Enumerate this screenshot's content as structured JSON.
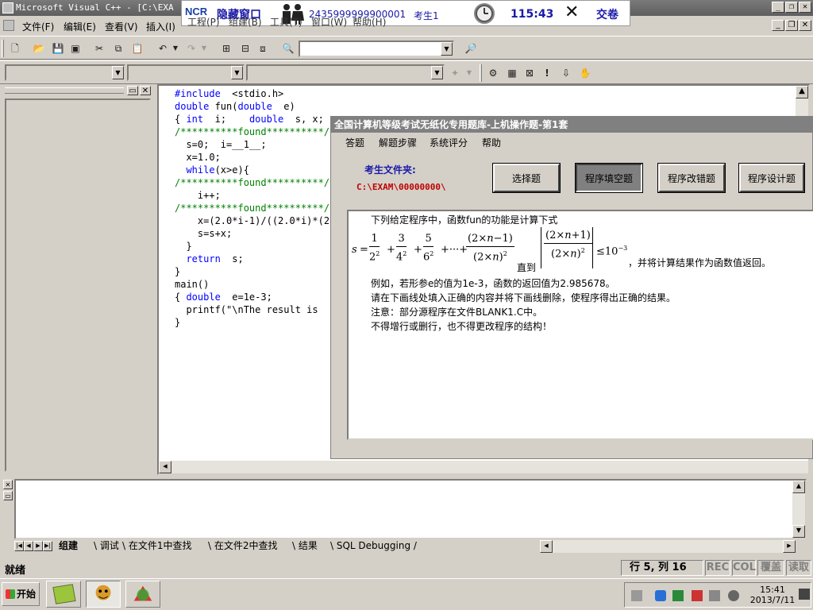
{
  "window": {
    "title": "Microsoft Visual C++ - [C:\\EXA"
  },
  "banner": {
    "logo": "NCR",
    "hide_window": "隐藏窗口",
    "exam_id": "2435999999900001",
    "examinee": "考生1",
    "timer": "115:43",
    "submit": "交卷"
  },
  "menu": [
    "文件(F)",
    "编辑(E)",
    "查看(V)",
    "插入(I)",
    "工程(P)",
    "组建(B)",
    "工具(T)",
    "窗口(W)",
    "帮助(H)"
  ],
  "code": {
    "lines": [
      "#include  <stdio.h>",
      "double fun(double  e)",
      "{ int  i;    double  s, x;",
      "/**********found**********/",
      "  s=0;  i=__1__;",
      "  x=1.0;",
      "  while(x>e){",
      "/**********found**********/",
      "    i++;",
      "/**********found**********/",
      "    x=(2.0*i-1)/((2.0*i)*(2.0*i));",
      "    s=s+x;",
      "  }",
      "  return  s;",
      "}",
      "main()",
      "{ double  e=1e-3;",
      "  printf(\"\\nThe result is",
      "}"
    ]
  },
  "dialog": {
    "title": "全国计算机等级考试无纸化专用题库-上机操作题-第1套",
    "menu": [
      "答题",
      "解题步骤",
      "系统评分",
      "帮助"
    ],
    "folder_label": "考生文件夹:",
    "folder_path": "C:\\EXAM\\00000000\\",
    "buttons": [
      "选择题",
      "程序填空题",
      "程序改错题",
      "程序设计题"
    ],
    "active_button": "程序填空题",
    "question": {
      "line1": "下列给定程序中，函数fun的功能是计算下式",
      "formula_until": "直到",
      "formula_tail": "，并将计算结果作为函数值返回。",
      "line2": "例如，若形参e的值为1e-3，函数的返回值为2.985678。",
      "line3": "请在下画线处填入正确的内容并将下画线删除，使程序得出正确的结果。",
      "line4": "注意：部分源程序在文件BLANK1.C中。",
      "line5": "不得增行或删行，也不得更改程序的结构！"
    }
  },
  "output_tabs": [
    "组建",
    "调试",
    "在文件1中查找",
    "在文件2中查找",
    "结果",
    "SQL Debugging"
  ],
  "status": {
    "ready": "就绪",
    "row_col": "行 5, 列 16",
    "indicators": [
      "REC",
      "COL",
      "覆盖",
      "读取"
    ]
  },
  "taskbar": {
    "start": "开始",
    "time": "15:41",
    "date": "2013/7/11"
  }
}
